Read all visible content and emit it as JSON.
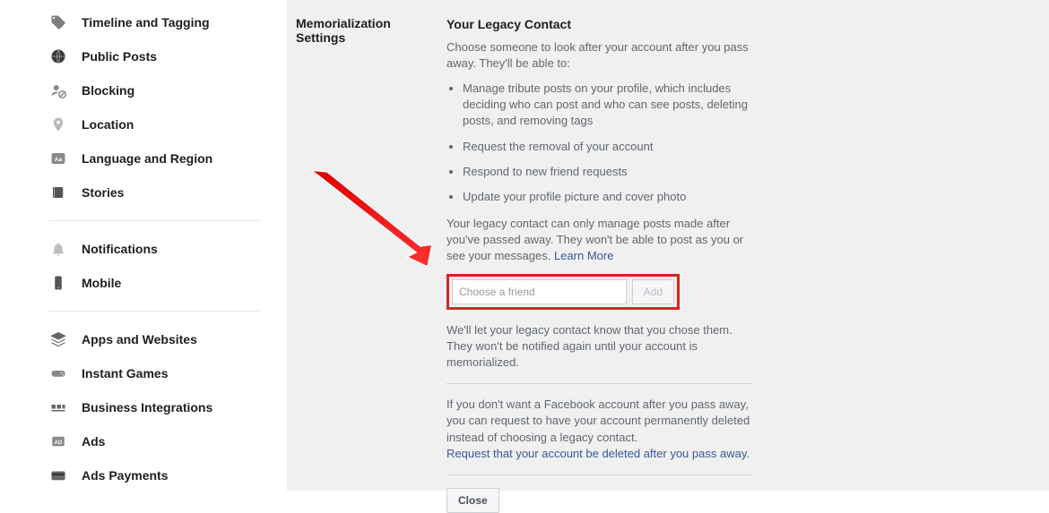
{
  "sidebar": {
    "groups": [
      {
        "items": [
          {
            "icon": "tag",
            "label": "Timeline and Tagging"
          },
          {
            "icon": "globe",
            "label": "Public Posts"
          },
          {
            "icon": "block",
            "label": "Blocking"
          },
          {
            "icon": "location",
            "label": "Location"
          },
          {
            "icon": "language",
            "label": "Language and Region"
          },
          {
            "icon": "stories",
            "label": "Stories"
          }
        ]
      },
      {
        "items": [
          {
            "icon": "bell",
            "label": "Notifications"
          },
          {
            "icon": "mobile",
            "label": "Mobile"
          }
        ]
      },
      {
        "items": [
          {
            "icon": "apps",
            "label": "Apps and Websites"
          },
          {
            "icon": "games",
            "label": "Instant Games"
          },
          {
            "icon": "business",
            "label": "Business Integrations"
          },
          {
            "icon": "ads",
            "label": "Ads"
          },
          {
            "icon": "payments",
            "label": "Ads Payments"
          }
        ]
      }
    ]
  },
  "main": {
    "section_title": "Memorialization Settings",
    "heading": "Your Legacy Contact",
    "intro": "Choose someone to look after your account after you pass away. They'll be able to:",
    "bullets": [
      "Manage tribute posts on your profile, which includes deciding who can post and who can see posts, deleting posts, and removing tags",
      "Request the removal of your account",
      "Respond to new friend requests",
      "Update your profile picture and cover photo"
    ],
    "note_prefix": "Your legacy contact can only manage posts made after you've passed away. They won't be able to post as you or see your messages. ",
    "learn_more": "Learn More",
    "friend_placeholder": "Choose a friend",
    "add_label": "Add",
    "after_input": "We'll let your legacy contact know that you chose them. They won't be notified again until your account is memorialized.",
    "delete_prefix": "If you don't want a Facebook account after you pass away, you can request to have your account permanently deleted instead of choosing a legacy contact.",
    "delete_link": "Request that your account be deleted after you pass away.",
    "close_label": "Close"
  }
}
